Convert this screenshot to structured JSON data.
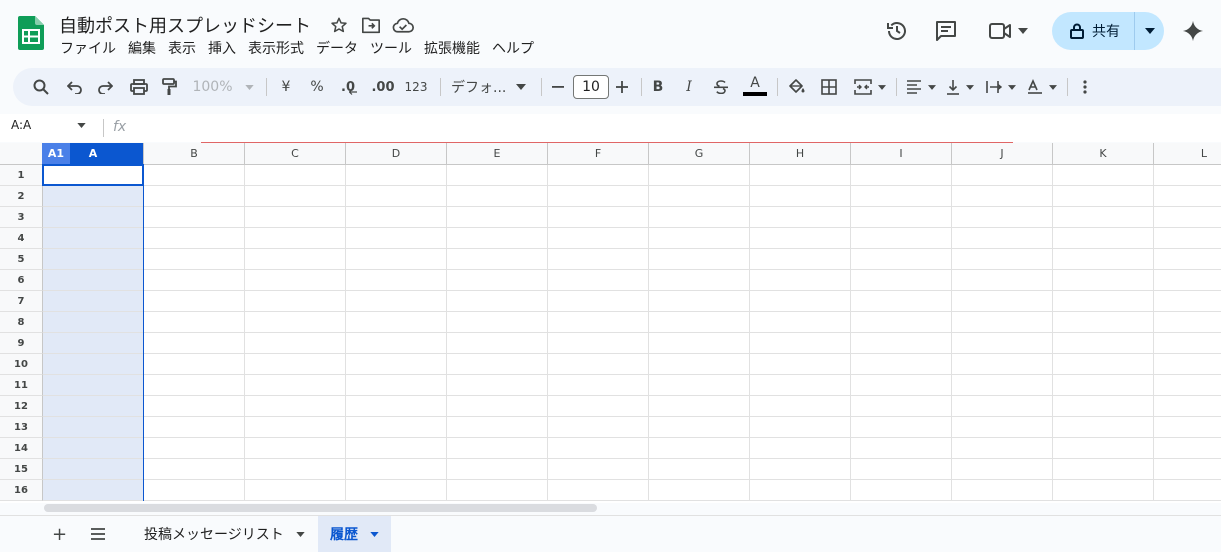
{
  "doc": {
    "title": "自動ポスト用スプレッドシート"
  },
  "menu": [
    "ファイル",
    "編集",
    "表示",
    "挿入",
    "表示形式",
    "データ",
    "ツール",
    "拡張機能",
    "ヘルプ"
  ],
  "share": {
    "label": "共有"
  },
  "toolbar": {
    "zoom": "100%",
    "currency": "¥",
    "percent": "%",
    "dec_decrease": ".0",
    "dec_increase": ".00",
    "format_123": "123",
    "font": "デフォ...",
    "font_size": "10",
    "bold": "B",
    "italic": "I",
    "text_color_letter": "A"
  },
  "formula_bar": {
    "name_box": "A:A",
    "fx": "fx"
  },
  "grid": {
    "corner_label": "A1",
    "columns": [
      "A",
      "B",
      "C",
      "D",
      "E",
      "F",
      "G",
      "H",
      "I",
      "J",
      "K",
      "L"
    ],
    "rows": [
      "1",
      "2",
      "3",
      "4",
      "5",
      "6",
      "7",
      "8",
      "9",
      "10",
      "11",
      "12",
      "13",
      "14",
      "15",
      "16"
    ]
  },
  "sheets": {
    "add": "+",
    "list": "≡",
    "tabs": [
      {
        "label": "投稿メッセージリスト",
        "active": false
      },
      {
        "label": "履歴",
        "active": true
      }
    ]
  },
  "colors": {
    "accent": "#0b57d0",
    "share_bg": "#c2e7ff",
    "selection": "#e1e9f7",
    "green": "#0f9d58"
  }
}
